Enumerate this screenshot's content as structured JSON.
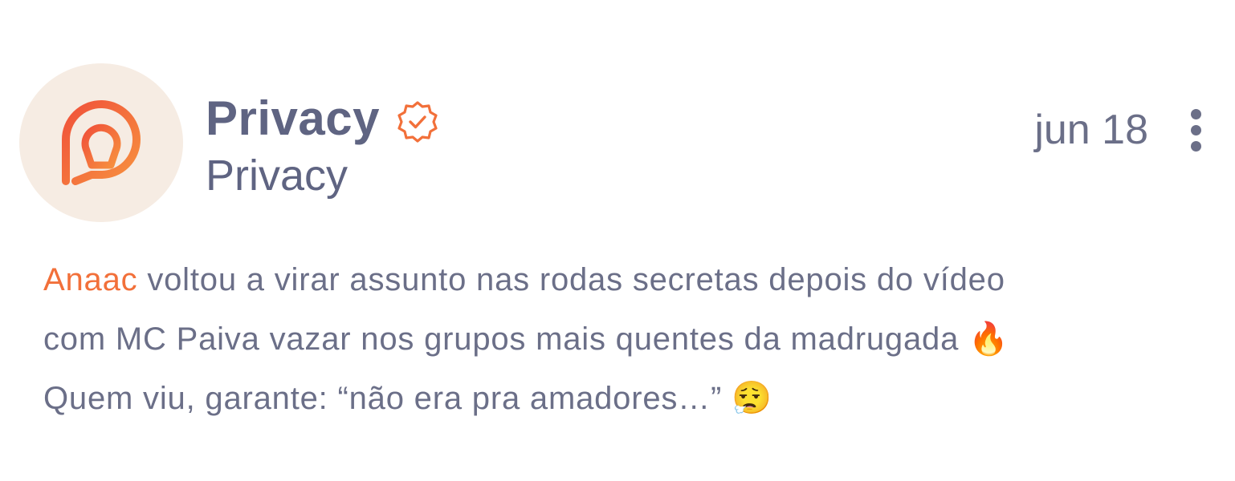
{
  "post": {
    "display_name": "Privacy",
    "handle": "Privacy",
    "date": "jun 18",
    "verified_icon": "verified-badge-icon",
    "more_icon": "more-vertical-icon",
    "avatar_icon": "privacy-logo-icon",
    "colors": {
      "accent": "#f2703a",
      "logo_gradient_start": "#f0513a",
      "logo_gradient_end": "#f7913f",
      "avatar_bg": "#f6ece3",
      "text": "#6b6f88"
    },
    "body": {
      "mention": "Anaac",
      "line1": " voltou a virar assunto nas rodas secretas depois do vídeo",
      "line2": "com MC Paiva vazar nos grupos mais quentes da madrugada 🔥",
      "line3": "Quem viu, garante: “não era pra amadores…” 😮‍💨"
    }
  }
}
